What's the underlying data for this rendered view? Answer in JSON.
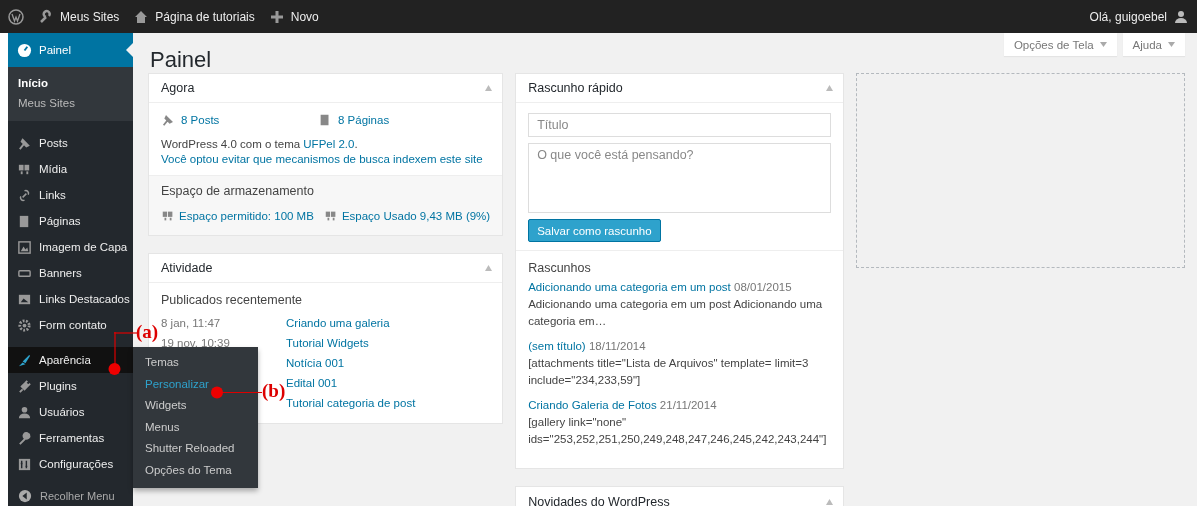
{
  "topbar": {
    "items": [
      {
        "label": "Meus Sites"
      },
      {
        "label": "Página de tutoriais"
      },
      {
        "label": "Novo"
      }
    ],
    "greeting": "Olá, guigoebel"
  },
  "sidebar": {
    "sections": [
      [
        {
          "label": "Painel",
          "selected": true,
          "open": false,
          "children": [
            {
              "label": "Início",
              "selected": true
            },
            {
              "label": "Meus Sites",
              "selected": false
            }
          ]
        }
      ],
      [
        {
          "label": "Posts",
          "selected": false,
          "open": false
        },
        {
          "label": "Mídia",
          "selected": false,
          "open": false
        },
        {
          "label": "Links",
          "selected": false,
          "open": false
        },
        {
          "label": "Páginas",
          "selected": false,
          "open": false
        },
        {
          "label": "Imagem de Capa",
          "selected": false,
          "open": false
        },
        {
          "label": "Banners",
          "selected": false,
          "open": false
        },
        {
          "label": "Links Destacados",
          "selected": false,
          "open": false
        },
        {
          "label": "Form contato",
          "selected": false,
          "open": false
        }
      ],
      [
        {
          "label": "Aparência",
          "selected": false,
          "open": true,
          "children": [
            {
              "label": "Temas",
              "selected": false
            },
            {
              "label": "Personalizar",
              "selected": true
            },
            {
              "label": "Widgets",
              "selected": false
            },
            {
              "label": "Menus",
              "selected": false
            },
            {
              "label": "Shutter Reloaded",
              "selected": false
            },
            {
              "label": "Opções do Tema",
              "selected": false
            }
          ]
        },
        {
          "label": "Plugins",
          "selected": false,
          "open": false
        },
        {
          "label": "Usuários",
          "selected": false,
          "open": false
        },
        {
          "label": "Ferramentas",
          "selected": false,
          "open": false
        },
        {
          "label": "Configurações",
          "selected": false,
          "open": false
        }
      ]
    ],
    "collapse": "Recolher Menu"
  },
  "main": {
    "title": "Painel",
    "screen_buttons": [
      {
        "label": "Opções de Tela"
      },
      {
        "label": "Ajuda"
      }
    ],
    "agora": {
      "title": "Agora",
      "counts": [
        {
          "label": "8 Posts"
        },
        {
          "label": "8 Páginas"
        }
      ],
      "version_text": "WordPress 4.0 com o tema ",
      "theme_link": "UFPel 2.0",
      "version_end": ".",
      "search_notice": "Você optou evitar que mecanismos de busca indexem este site",
      "storage_title": "Espaço de armazenamento",
      "storage": [
        {
          "label": "Espaço permitido: 100 MB"
        },
        {
          "label": "Espaço Usado 9,43 MB (9%)"
        }
      ]
    },
    "atividade": {
      "title": "Atividade",
      "subtitle": "Publicados recentemente",
      "rows": [
        {
          "date": "8 jan, 11:47",
          "title": "Criando uma galeria"
        },
        {
          "date": "19 nov, 10:39",
          "title": "Tutorial Widgets"
        },
        {
          "title": "Notícia 001"
        },
        {
          "title": "Edital 001"
        },
        {
          "title": "Tutorial categoria de post"
        }
      ]
    },
    "quick_draft": {
      "title": "Rascunho rápido",
      "title_placeholder": "Título",
      "content_placeholder": "O que você está pensando?",
      "button": "Salvar como rascunho",
      "drafts_heading": "Rascunhos",
      "drafts": [
        {
          "title": "Adicionando uma categoria em um post",
          "date": "08/01/2015",
          "excerpt": "Adicionando uma categoria em um post Adicionando uma categoria em…"
        },
        {
          "title": "(sem título)",
          "date": "18/11/2014",
          "excerpt": "[attachments title=\"Lista de Arquivos\" template= limit=3 include=\"234,233,59\"]"
        },
        {
          "title": "Criando Galeria de Fotos",
          "date": "21/11/2014",
          "excerpt": "[gallery link=\"none\" ids=\"253,252,251,250,249,248,247,246,245,242,243,244\"]"
        }
      ]
    },
    "news": {
      "title": "Novidades do WordPress"
    }
  },
  "annotations": [
    {
      "label": "(a)"
    },
    {
      "label": "(b)"
    }
  ]
}
